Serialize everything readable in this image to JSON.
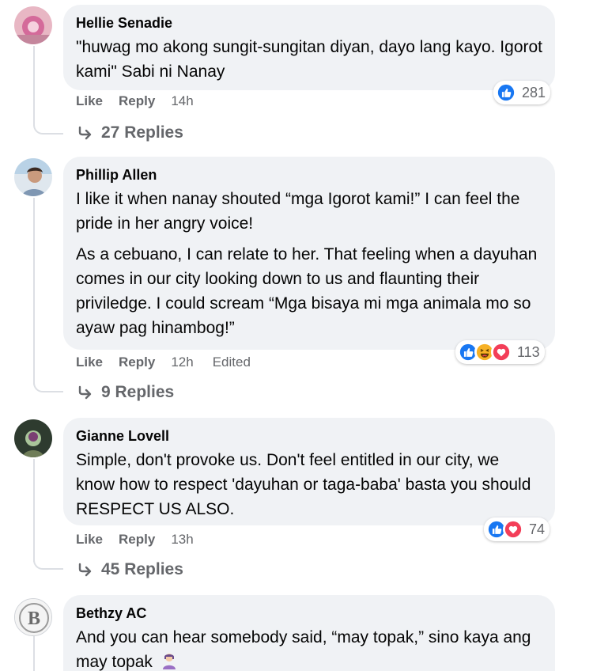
{
  "comments": [
    {
      "author": "Hellie Senadie",
      "text": "\"huwag mo akong sungit-sungitan diyan, dayo lang kayo. Igorot kami\" Sabi ni Nanay",
      "like_label": "Like",
      "reply_label": "Reply",
      "time": "14h",
      "reaction_count": "281",
      "reactions": [
        "like-icon"
      ],
      "replies_label": "27 Replies"
    },
    {
      "author": "Phillip Allen",
      "text": "I like it when nanay shouted “mga Igorot kami!” I can feel the pride in her angry voice!",
      "text2": "As a cebuano, I can relate to her. That feeling when a dayuhan comes in our city looking down to us and flaunting their priviledge. I could scream “Mga bisaya mi mga animala mo so ayaw pag hinambog!”",
      "like_label": "Like",
      "reply_label": "Reply",
      "time": "12h",
      "edited_label": "Edited",
      "reaction_count": "113",
      "reactions": [
        "like-icon",
        "haha-icon",
        "love-icon"
      ],
      "replies_label": "9 Replies"
    },
    {
      "author": "Gianne Lovell",
      "text": "Simple, don't provoke us. Don't feel entitled in our city, we know how to respect 'dayuhan or taga-baba' basta you should RESPECT US ALSO.",
      "like_label": "Like",
      "reply_label": "Reply",
      "time": "13h",
      "reaction_count": "74",
      "reactions": [
        "like-icon",
        "love-icon"
      ],
      "replies_label": "45 Replies"
    },
    {
      "author": "Bethzy AC",
      "text": "And you can hear somebody said, “may topak,” sino kaya ang may topak",
      "emoji": "woman-gesturing-icon"
    }
  ],
  "colors": {
    "bubble": "#f0f2f5",
    "meta_text": "#65676b",
    "like_blue": "#1877f2",
    "love_red": "#f33e58",
    "haha_yellow": "#f7b125"
  }
}
